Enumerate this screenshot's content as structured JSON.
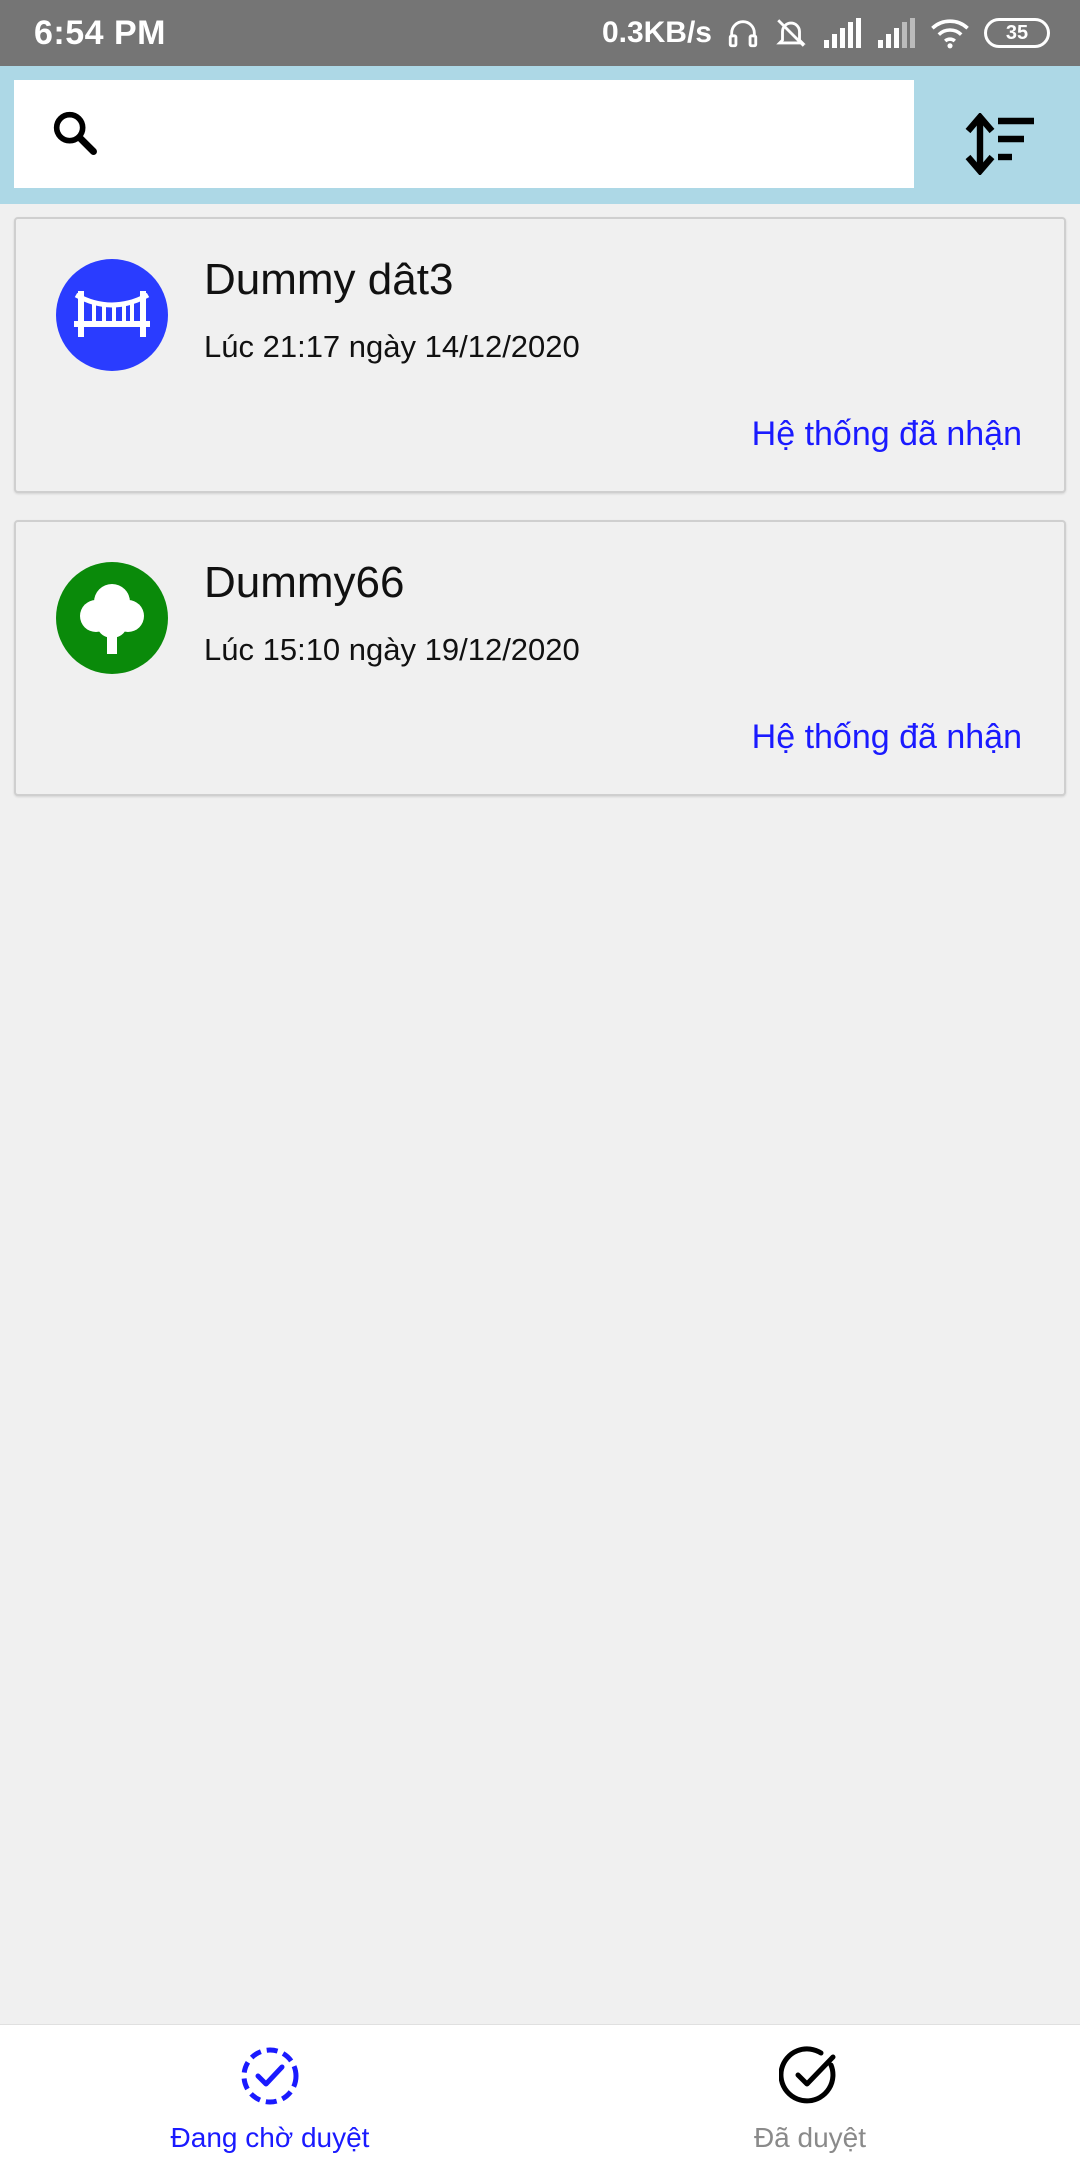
{
  "status_bar": {
    "time": "6:54 PM",
    "net_speed": "0.3KB/s",
    "battery": "35",
    "icons": [
      "headphones-icon",
      "muted-bell-icon",
      "signal-icon",
      "signal-icon",
      "wifi-icon",
      "battery-icon"
    ]
  },
  "search": {
    "value": "",
    "placeholder": "",
    "icon": "search-icon",
    "sort_icon": "sort-icon"
  },
  "colors": {
    "header_bg": "#add8e6",
    "accent": "#1a1aff",
    "bridge_avatar": "#2a3cff",
    "tree_avatar": "#0a8a0a",
    "background": "#f0f0f0"
  },
  "items": [
    {
      "title": "Dummy dât3",
      "time": "Lúc 21:17 ngày 14/12/2020",
      "status": "Hệ thống đã nhận",
      "icon": "bridge-icon"
    },
    {
      "title": "Dummy66",
      "time": "Lúc 15:10 ngày 19/12/2020",
      "status": "Hệ thống đã nhận",
      "icon": "tree-icon"
    }
  ],
  "bottom_nav": {
    "tabs": [
      {
        "label": "Đang chờ duyệt",
        "icon": "pending-check-icon",
        "active": true
      },
      {
        "label": "Đã duyệt",
        "icon": "check-circle-icon",
        "active": false
      }
    ]
  }
}
